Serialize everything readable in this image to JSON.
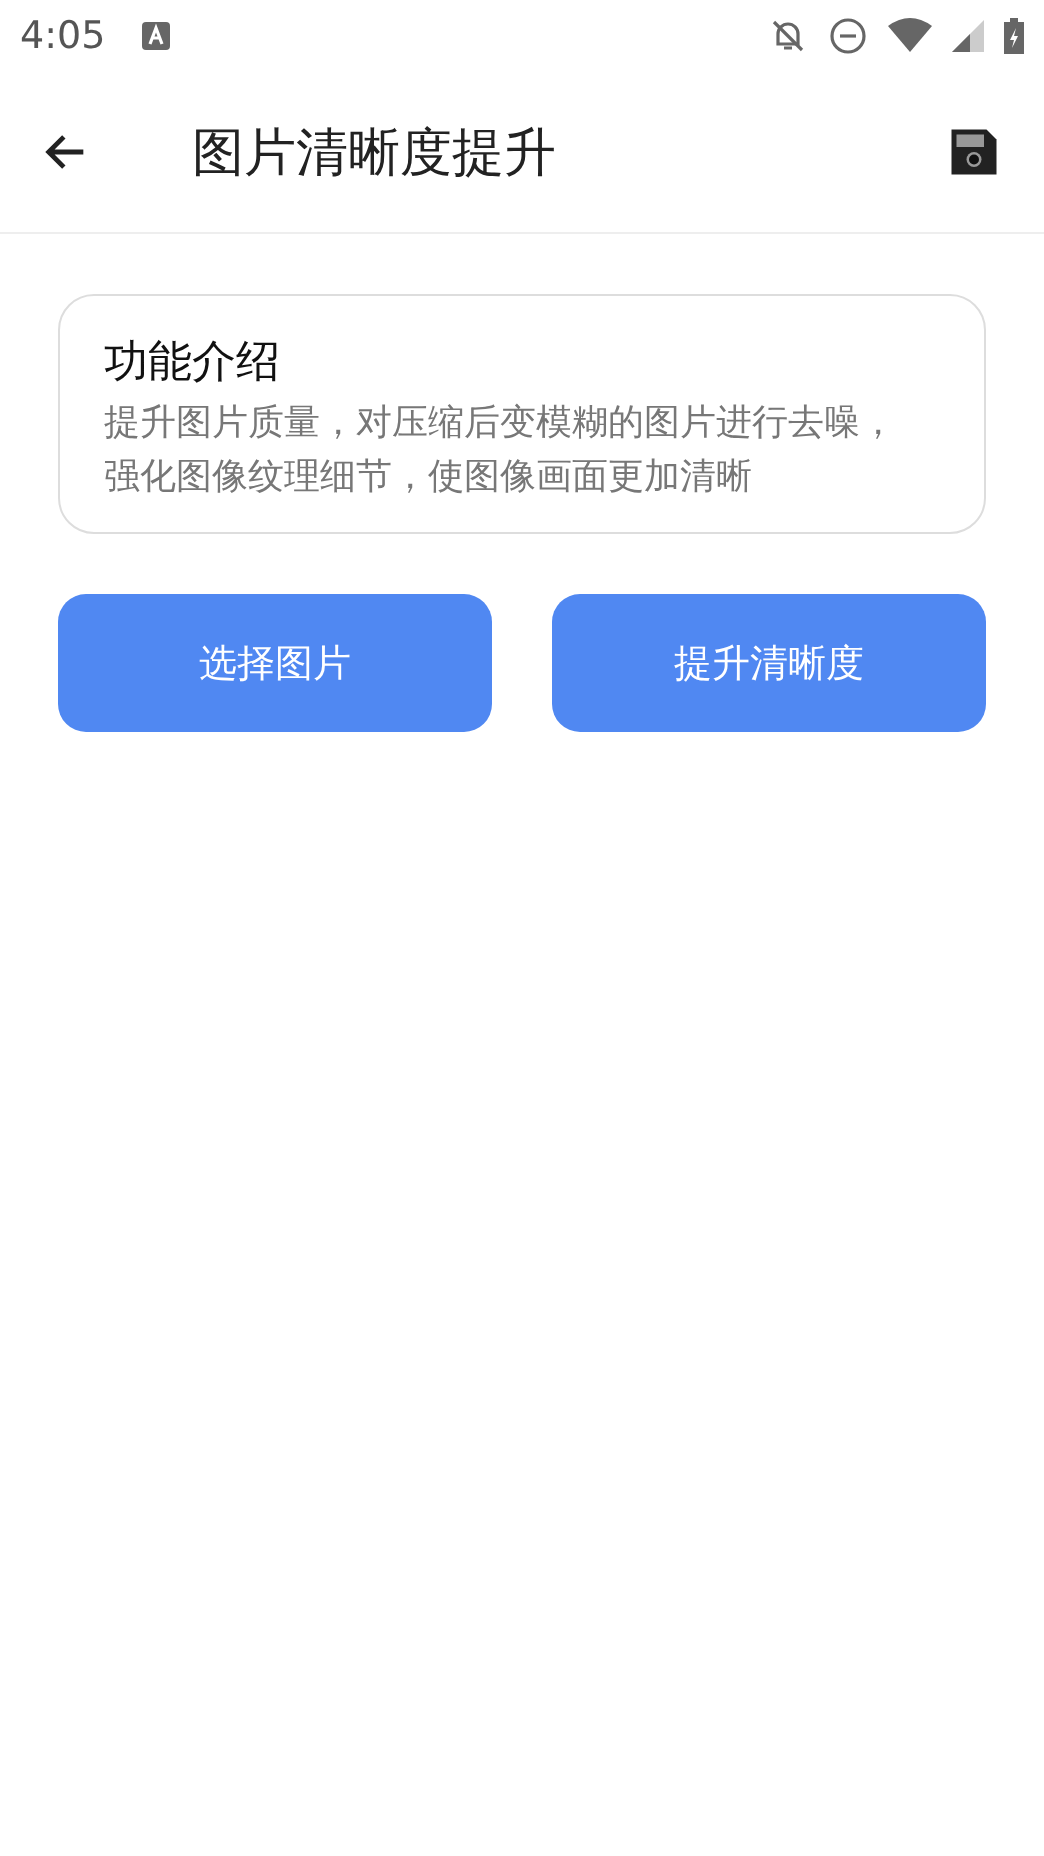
{
  "status_bar": {
    "time": "4:05"
  },
  "app_bar": {
    "title": "图片清晰度提升"
  },
  "intro_card": {
    "title": "功能介绍",
    "description": "提升图片质量，对压缩后变模糊的图片进行去噪，强化图像纹理细节，使图像画面更加清晰"
  },
  "buttons": [
    {
      "label": "选择图片"
    },
    {
      "label": "提升清晰度"
    }
  ]
}
